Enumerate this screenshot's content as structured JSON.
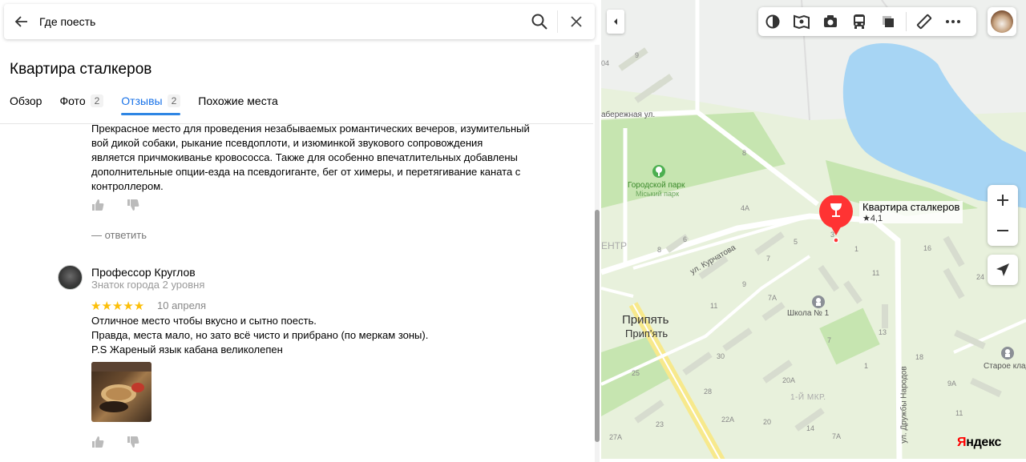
{
  "search": {
    "query": "Где поесть"
  },
  "place": {
    "title": "Квартира сталкеров"
  },
  "tabs": [
    {
      "label": "Обзор",
      "count": ""
    },
    {
      "label": "Фото",
      "count": "2"
    },
    {
      "label": "Отзывы",
      "count": "2"
    },
    {
      "label": "Похожие места",
      "count": ""
    }
  ],
  "review1": {
    "text_lines": [
      "Прекрасное место для проведения незабываемых романтических вечеров, изумительный",
      "вой дикой собаки, рыкание псевдоплоти, и изюминкой звукового сопровождения",
      "является причмокиванье кровососса. Также для особенно впечатлительных добавлены",
      "дополнительные опции-езда на псевдогиганте, бег от химеры, и перетягивание каната с",
      "контроллером."
    ],
    "reply_label": "— ответить"
  },
  "review2": {
    "author": "Профессор Круглов",
    "level": "Знаток города 2 уровня",
    "rating": 5,
    "stars": "★★★★★",
    "date": "10 апреля",
    "text_lines": [
      "Отличное место чтобы вкусно и сытно поесть.",
      "Правда, места мало, но зато всё чисто и прибрано (по меркам зоны).",
      "P.S Жареный язык кабана великолепен"
    ]
  },
  "map": {
    "pin_name": "Квартира сталкеров",
    "pin_rating": "★4,1",
    "city": "Припять",
    "city_ua": "Прип'ять",
    "park": "Городской парк",
    "park_ua": "Міський парк",
    "school": "Школа № 1",
    "district": "1-Й МКР.",
    "street1": "ул. Курчатова",
    "street2": "ул. Дружбы Народов",
    "street3": "абережная ул.",
    "old_cemetery": "Старое кладб",
    "logo_ya": "Я",
    "logo_rest": "ндекс",
    "center_label": "ЕНТР",
    "numbers": [
      {
        "t": "04"
      },
      {
        "t": "9"
      },
      {
        "t": "8"
      },
      {
        "t": "4А"
      },
      {
        "t": "6"
      },
      {
        "t": "8"
      },
      {
        "t": "5"
      },
      {
        "t": "7"
      },
      {
        "t": "3"
      },
      {
        "t": "1"
      },
      {
        "t": "16"
      },
      {
        "t": "24"
      },
      {
        "t": "9"
      },
      {
        "t": "7А"
      },
      {
        "t": "11"
      },
      {
        "t": "11"
      },
      {
        "t": "13"
      },
      {
        "t": "18"
      },
      {
        "t": "30"
      },
      {
        "t": "25"
      },
      {
        "t": "28"
      },
      {
        "t": "20А"
      },
      {
        "t": "22А"
      },
      {
        "t": "20"
      },
      {
        "t": "23"
      },
      {
        "t": "27А"
      },
      {
        "t": "14"
      },
      {
        "t": "7А"
      },
      {
        "t": "9А"
      },
      {
        "t": "11"
      },
      {
        "t": "7"
      },
      {
        "t": "1"
      }
    ],
    "colors": {
      "water": "#a7d5f4",
      "land": "#e8f1dc",
      "park": "#c6e5b0",
      "road": "#ffffff",
      "pin": "#f33"
    }
  }
}
